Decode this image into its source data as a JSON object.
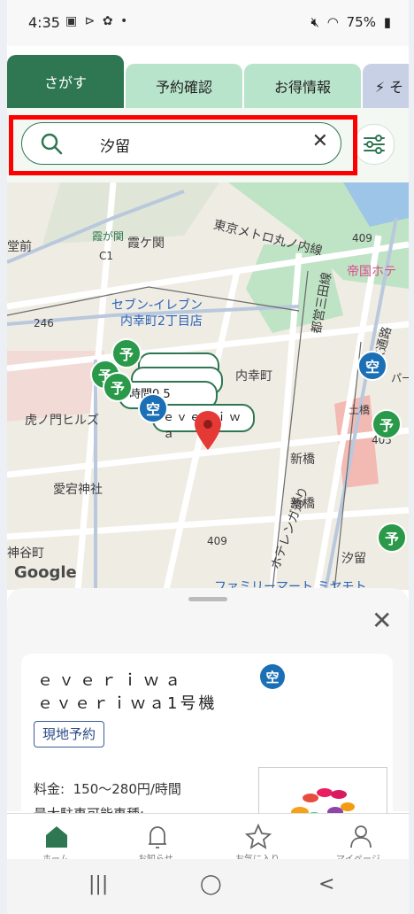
{
  "status_bar": {
    "time": "4:35",
    "icons_left": "▣ ⊳ ✿ •",
    "battery": "75%"
  },
  "tabs": [
    {
      "label": "さがす"
    },
    {
      "label": "予約確認"
    },
    {
      "label": "お得情報"
    },
    {
      "label": "⚡ そ"
    }
  ],
  "search": {
    "value": "汐留",
    "clear_icon": "✕",
    "icon": "search-icon"
  },
  "map": {
    "labels": [
      "堂前",
      "霞が関",
      "霞ケ関",
      "C1",
      "東京メトロ丸ノ内線",
      "帝国ホテ",
      "409",
      "セブン-イレブン",
      "内幸町2丁目店",
      "246",
      "都営三田線",
      "内幸町",
      "虎ノ門ヒルズ",
      "新橋",
      "愛宕神社",
      "新橋",
      "ホテレンガ通り",
      "神谷町",
      "汐留",
      "ファミリーマート ミヤモト",
      "土橋",
      "409",
      "東京通路",
      "パー",
      "405"
    ],
    "pin_labels": [
      "予",
      "空",
      "予",
      "予",
      "空",
      "予",
      "予"
    ],
    "card_labels": [
      "時間0.5",
      "ｅｖｅｒｉｗａ"
    ],
    "google": "Google"
  },
  "sheet": {
    "close": "✕",
    "name_line1": "ｅｖｅｒｉｗａ",
    "name_line2": "ｅｖｅｒｉｗａ1号機",
    "status_badge": "空",
    "reserve_tag": "現地予約",
    "price_label": "料金:",
    "price_value": "150～280円/時間",
    "cars_label": "最大駐車可能車種:"
  },
  "bottom_nav": [
    {
      "label": "ホーム",
      "icon": "home-icon"
    },
    {
      "label": "お知らせ",
      "icon": "bell-icon"
    },
    {
      "label": "お気に入り",
      "icon": "star-icon"
    },
    {
      "label": "マイページ",
      "icon": "person-icon"
    }
  ],
  "system_nav": {
    "recent": "|||",
    "home": "◯",
    "back": "<"
  },
  "colors": {
    "primary": "#2e7752",
    "tab_light": "#b9e4cc",
    "pin_green": "#2a9a4a",
    "pin_blue": "#1a6fb5",
    "highlight": "#ff0000"
  }
}
